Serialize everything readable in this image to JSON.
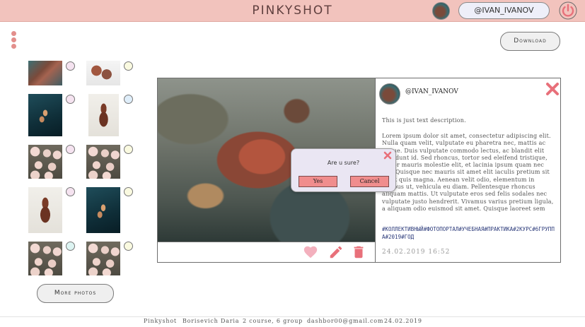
{
  "header": {
    "title": "PINKYSHOT",
    "username": "@IVAN_IVANOV"
  },
  "toolbar": {
    "download_label": "Download"
  },
  "thumbnails": [
    {
      "image": "turtle"
    },
    {
      "image": "turtle-cutout"
    },
    {
      "image": "dancer"
    },
    {
      "image": "violin"
    },
    {
      "image": "roses"
    },
    {
      "image": "roses"
    },
    {
      "image": "violin"
    },
    {
      "image": "dancer"
    },
    {
      "image": "roses"
    },
    {
      "image": "roses"
    }
  ],
  "more_label": "More photos",
  "post": {
    "username": "@IVAN_IVANOV",
    "description": "This is just text description.",
    "body": "Lorem ipsum dolor sit amet, consectetur adipiscing elit. Nulla quam velit, vulputate eu pharetra nec, mattis ac neque. Duis vulputate commodo lectus, ac blandit elit tincidunt id. Sed rhoncus, tortor sed eleifend tristique, tortor mauris molestie elit, et lacinia ipsum quam nec dui. Quisque nec mauris sit amet elit iaculis pretium sit amet quis magna. Aenean velit odio, elementum in tempus ut, vehicula eu diam. Pellentesque rhoncus aliquam mattis. Ut vulputate eros sed felis sodales nec vulputate justo hendrerit. Vivamus varius pretium ligula, a aliquam odio euismod sit amet. Quisque laoreet sem sit amet orci",
    "tags": "#КОЛЛЕКТИВНЫЙ#ФОТОПОРТАЛ#УЧЕБНАЯ#ПРАКТИКА#2КУРС#6ГРУППА#2019#ГОД",
    "date": "24.02.2019 16:52"
  },
  "dialog": {
    "question": "Are u sure?",
    "yes_label": "Yes",
    "cancel_label": "Cancel"
  },
  "footer": {
    "brand": "Pinkyshot",
    "author": "Borisevich Daria",
    "course": "2 course, 6 group",
    "email": "dashbor00@gmail.com",
    "date": "24.02.2019"
  },
  "colors": {
    "header_bg": "#f2c3bd",
    "accent": "#e8707a",
    "selector_pink": "#f5e3f0",
    "selector_yellow": "#fafae0",
    "selector_blue": "#dfeefa",
    "selector_teal": "#ddf4f2",
    "dialog_button": "#f08d8d"
  }
}
